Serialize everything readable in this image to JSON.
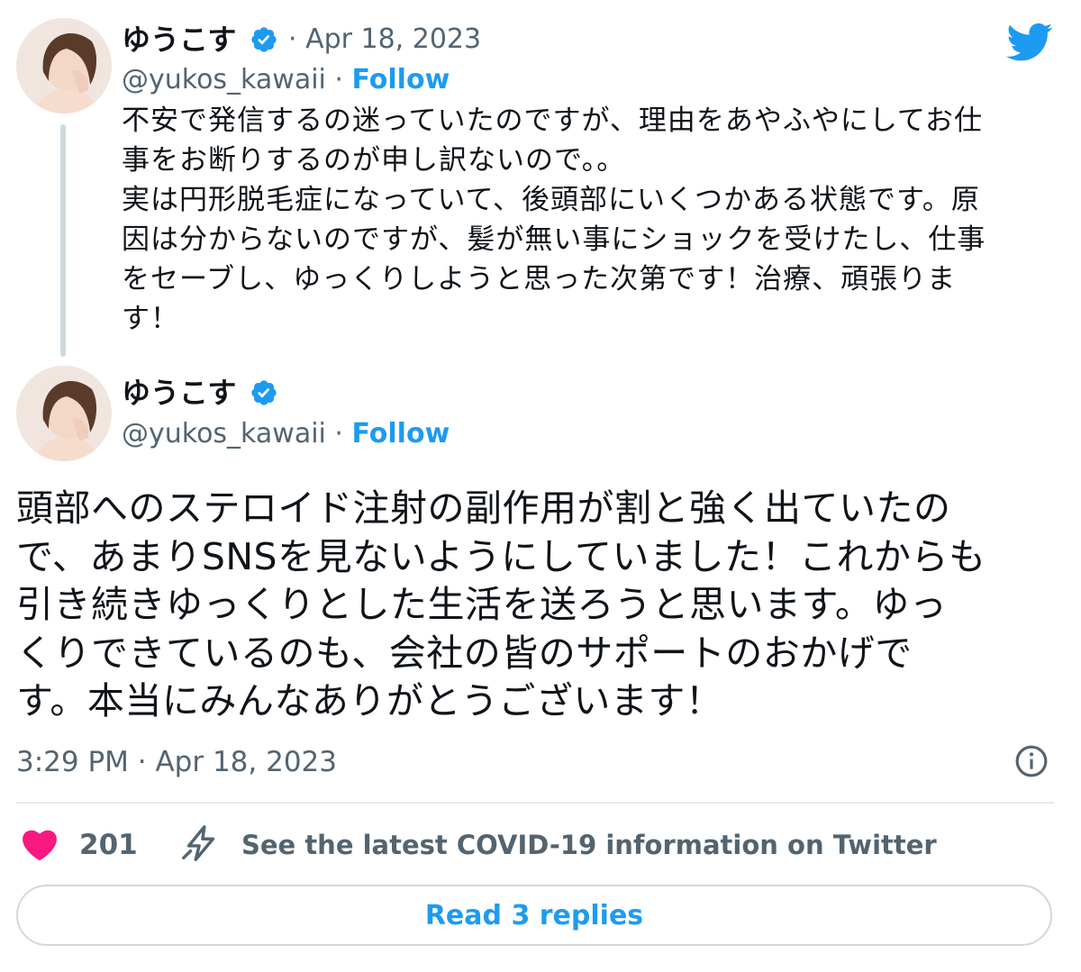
{
  "tweet1": {
    "display_name": "ゆうこす",
    "date": "· Apr 18, 2023",
    "handle": "@yukos_kawaii",
    "separator": "·",
    "follow_label": "Follow",
    "text": "不安で発信するの迷っていたのですが、理由をあやふやにしてお仕\n事をお断りするのが申し訳ないので。。\n実は円形脱毛症になっていて、後頭部にいくつかある状態です。原\n因は分からないのですが、髪が無い事にショックを受けたし、仕事\nをセーブし、ゆっくりしようと思った次第です！治療、頑張りま\nす！"
  },
  "tweet2": {
    "display_name": "ゆうこす",
    "handle": "@yukos_kawaii",
    "separator": "·",
    "follow_label": "Follow",
    "text": "頭部へのステロイド注射の副作用が割と強く出ていたの\nで、あまりSNSを見ないようにしていました！これからも\n引き続きゆっくりとした生活を送ろうと思います。ゆっ\nくりできているのも、会社の皆のサポートのおかげで\nす。本当にみんなありがとうございます！",
    "timestamp": "3:29 PM · Apr 18, 2023"
  },
  "actions": {
    "like_count": "201",
    "covid_link": "See the latest COVID-19 information on Twitter",
    "replies_button": "Read 3 replies"
  },
  "icons": {
    "twitter_logo": "twitter-bird-icon",
    "verified": "verified-badge-icon",
    "info": "info-icon",
    "like": "heart-icon",
    "covid": "lightning-bolt-icon"
  },
  "colors": {
    "twitter_blue": "#1d9bf0",
    "heart_pink": "#f91880",
    "secondary_text": "#536471",
    "primary_text": "#0f1419"
  }
}
